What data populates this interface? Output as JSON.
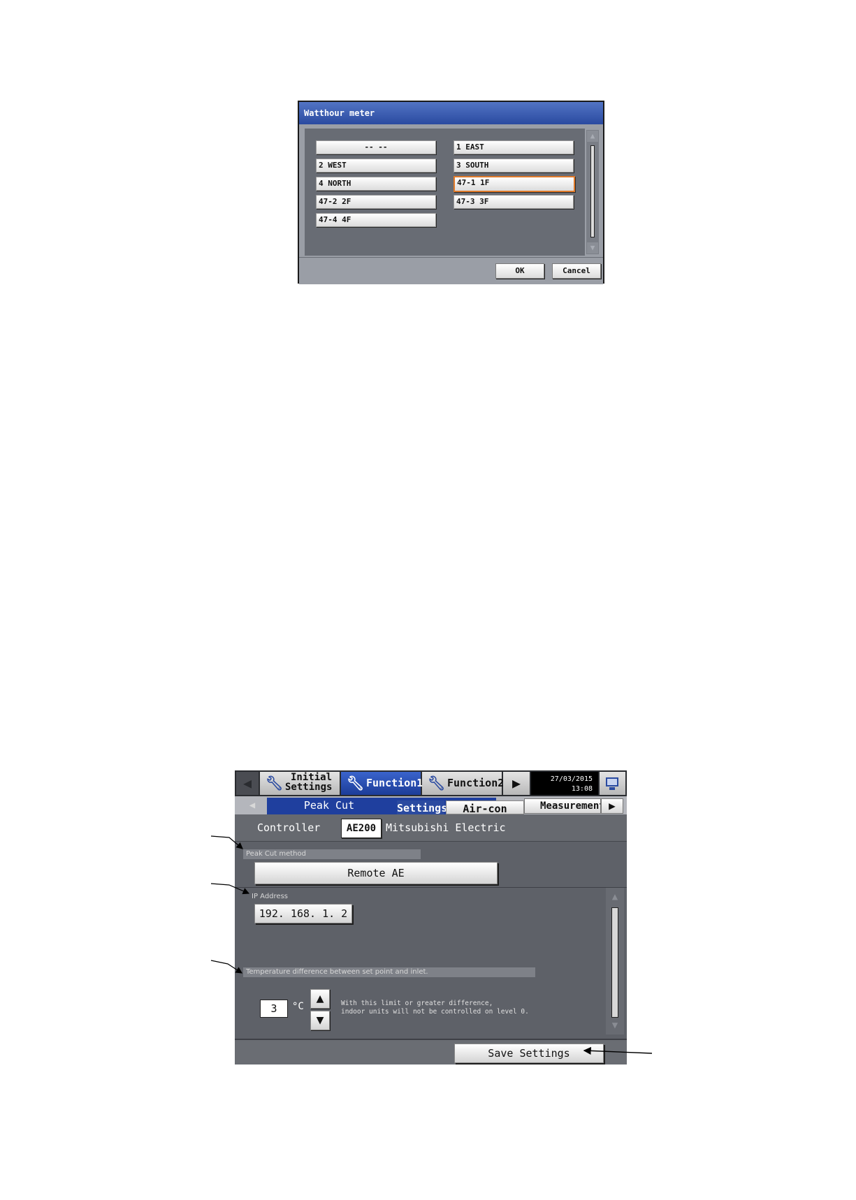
{
  "dialog": {
    "title": "Watthour meter",
    "items": [
      "-- --",
      "1 EAST",
      "2 WEST",
      "3 SOUTH",
      "4 NORTH",
      "47-1 1F",
      "47-2 2F",
      "47-3 3F",
      "47-4 4F"
    ],
    "selected": "47-1 1F",
    "ok_label": "OK",
    "cancel_label": "Cancel"
  },
  "screen": {
    "tabs": {
      "initial_line1": "Initial",
      "initial_line2": "Settings",
      "function1": "Function1",
      "function2": "Function2"
    },
    "clock": {
      "date": "27/03/2015",
      "time": "13:08"
    },
    "subtabs": {
      "group": "Peak Cut",
      "settings": "Settings",
      "aircon": "Air-con",
      "measurement": "Measurement"
    },
    "controller": {
      "label": "Controller",
      "model": "AE200",
      "name": "Mitsubishi Electric"
    },
    "peak_cut_method": {
      "label": "Peak Cut method",
      "value": "Remote AE"
    },
    "ip_address": {
      "label": "IP Address",
      "value": "192. 168. 1. 2"
    },
    "temperature": {
      "label": "Temperature difference between set point and inlet.",
      "value": "3",
      "unit": "°C",
      "note_line1": "With this limit or greater difference,",
      "note_line2": "indoor units will not be controlled on level 0."
    },
    "save_label": "Save Settings"
  },
  "colors": {
    "title_blue": "#2a4aa0",
    "active_tab": "#1f3f9e",
    "selection_border": "#e07a2a",
    "panel_gray": "#5e6168"
  }
}
